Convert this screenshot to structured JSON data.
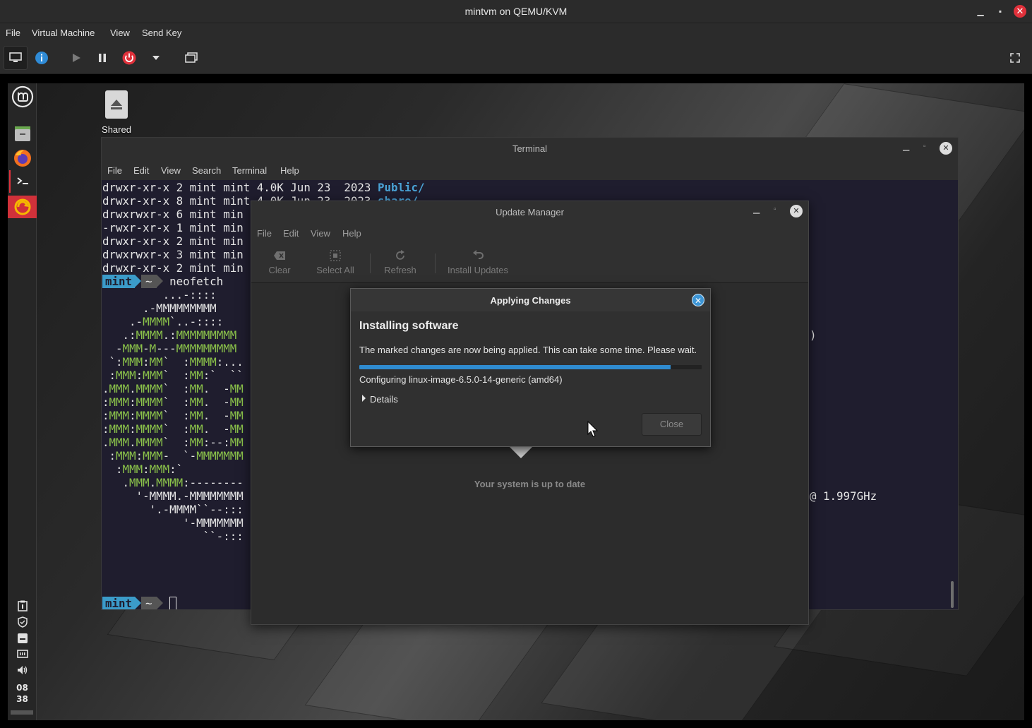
{
  "host": {
    "title": "mintvm on QEMU/KVM",
    "menus": [
      "File",
      "Virtual Machine",
      "View",
      "Send Key"
    ],
    "toolbar": {
      "icons": [
        "monitor-icon",
        "info-icon",
        "play-icon",
        "pause-icon",
        "power-icon",
        "dropdown-icon",
        "screens-icon",
        "fullscreen-icon"
      ]
    }
  },
  "desktop": {
    "shared_label": "Shared",
    "clock": {
      "hour": "08",
      "minute": "38"
    }
  },
  "terminal": {
    "title": "Terminal",
    "menus": [
      "File",
      "Edit",
      "View",
      "Search",
      "Terminal",
      "Help"
    ],
    "lines": [
      "drwxr-xr-x 2 mint mint 4.0K Jun 23  2023 ",
      "drwxr-xr-x 8 mint mint 4.0K Jun 23  2023 ",
      "drwxrwxr-x 6 mint min",
      "-rwxr-xr-x 1 mint min",
      "drwxr-xr-x 2 mint min",
      "drwxrwxr-x 3 mint min",
      "drwxr-xr-x 2 mint min"
    ],
    "dir_public": "Public/",
    "dir_share": "share/",
    "prompt_user": "mint",
    "prompt_dir": "~",
    "command": "neofetch",
    "art": [
      "         ...-::::",
      "      .-MMMMMMMMM",
      "    .-MMMM`..-::::",
      "   .:MMMM.:MMMMMMMMM",
      "  -MMM-M---MMMMMMMMM",
      " `:MMM:MM`  :MMMM:...",
      " :MMM:MMM`  :MM:`  ``",
      ".MMM.MMMM`  :MM.  -MM",
      ":MMM:MMMM`  :MM.  -MM",
      ":MMM:MMMM`  :MM.  -MM",
      ":MMM:MMMM`  :MM.  -MM",
      ".MMM.MMMM`  :MM:--:MM",
      " :MMM:MMM-  `-MMMMMMM",
      "  :MMM:MMM:`",
      "   .MMM.MMMM:--------",
      "     '-MMMM.-MMMMMMMM",
      "       '.-MMMM``--:::",
      "            '-MMMMMMM",
      "               ``-:::"
    ],
    "right_paren": ")",
    "cpu_freq": "@ 1.997GHz"
  },
  "update_manager": {
    "title": "Update Manager",
    "menus": [
      "File",
      "Edit",
      "View",
      "Help"
    ],
    "toolbar": {
      "clear": "Clear",
      "select_all": "Select All",
      "refresh": "Refresh",
      "install": "Install Updates"
    },
    "status": "Your system is up to date"
  },
  "dialog": {
    "title": "Applying Changes",
    "heading": "Installing software",
    "message": "The marked changes are now being applied. This can take some time. Please wait.",
    "progress": 0.91,
    "configuring": "Configuring linux-image-6.5.0-14-generic (amd64)",
    "details": "Details",
    "close": "Close",
    "accent": "#2f8bcf"
  }
}
